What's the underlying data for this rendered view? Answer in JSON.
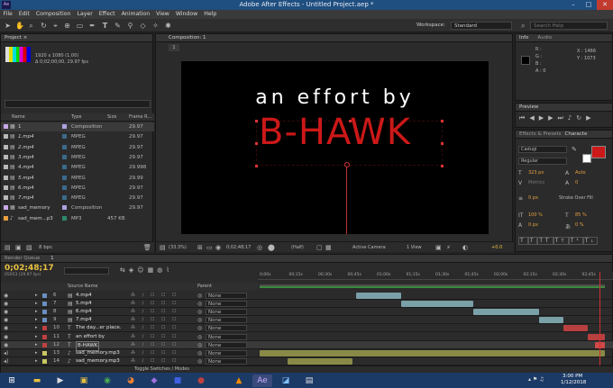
{
  "app": {
    "title": "Adobe After Effects - Untitled Project.aep *",
    "logo": "Ae",
    "menu": [
      "File",
      "Edit",
      "Composition",
      "Layer",
      "Effect",
      "Animation",
      "View",
      "Window",
      "Help"
    ],
    "workspace_label": "Workspace:",
    "workspace_value": "Standard",
    "search_placeholder": "Search Help"
  },
  "project": {
    "tab": "Project ×",
    "info_line1": "1920 x 1080 (1.00)",
    "info_line2": "Δ 0;02;00;00, 29.97 fps",
    "search_placeholder": "",
    "columns": [
      "Name",
      "Type",
      "Size",
      "Frame R..."
    ],
    "items": [
      {
        "name": "1",
        "type": "Composition",
        "size": "",
        "fps": "29.97",
        "color": "#c8a8e8"
      },
      {
        "name": "1.mp4",
        "type": "MPEG",
        "size": "",
        "fps": "29.97",
        "color": "#b8b8b8"
      },
      {
        "name": "2.mp4",
        "type": "MPEG",
        "size": "",
        "fps": "29.97",
        "color": "#b8b8b8"
      },
      {
        "name": "3.mp4",
        "type": "MPEG",
        "size": "",
        "fps": "29.97",
        "color": "#b8b8b8"
      },
      {
        "name": "4.mp4",
        "type": "MPEG",
        "size": "",
        "fps": "29.998",
        "color": "#b8b8b8"
      },
      {
        "name": "5.mp4",
        "type": "MPEG",
        "size": "",
        "fps": "29.99",
        "color": "#b8b8b8"
      },
      {
        "name": "6.mp4",
        "type": "MPEG",
        "size": "",
        "fps": "29.97",
        "color": "#b8b8b8"
      },
      {
        "name": "7.mp4",
        "type": "MPEG",
        "size": "",
        "fps": "29.97",
        "color": "#b8b8b8"
      },
      {
        "name": "sad_memory",
        "type": "Composition",
        "size": "",
        "fps": "29.97",
        "color": "#c8a8e8"
      },
      {
        "name": "sad_mem...p3",
        "type": "MP3",
        "size": "457 KB",
        "fps": "",
        "color": "#e8a040"
      }
    ],
    "bpc": "8 bpc"
  },
  "composition": {
    "tab": "Composition: 1",
    "sub_tab": "1",
    "line1": "an effort by",
    "line2": "B-HAWK",
    "zoom": "(33.3%)",
    "timecode": "0;02;48;17",
    "resolution": "(Half)",
    "camera": "Active Camera",
    "view": "1 View",
    "offset": "+0.0"
  },
  "info": {
    "tab": "Info",
    "tab2": "Audio",
    "r": "R :",
    "g": "G :",
    "b": "B :",
    "a": "A : 0",
    "x": "X : 1466",
    "y": "Y : 1073"
  },
  "preview": {
    "tab": "Preview"
  },
  "character": {
    "tab1": "Effects & Presets",
    "tab2": "Characte",
    "font": "Cadugi",
    "style": "Regular",
    "size": "323 px",
    "leading": "Auto",
    "tracking": "Metrics",
    "kerning": "0",
    "stroke_w": "0 px",
    "stroke_type": "Stroke Over Fill",
    "vscale": "100 %",
    "hscale": "85 %",
    "baseline": "0 px",
    "tsume": "0 %"
  },
  "timeline": {
    "render_tab": "Render Queue",
    "comp_tab": "1",
    "timecode": "0;02;48;17",
    "frames": "05053 (29.97 fps)",
    "header_source": "Source Name",
    "header_parent": "Parent",
    "ruler": [
      "0;00s",
      "00;15s",
      "00;30s",
      "00;45s",
      "01;00s",
      "01;15s",
      "01;30s",
      "01;45s",
      "02;00s",
      "02;15s",
      "02;30s",
      "02;45s"
    ],
    "layers": [
      {
        "num": "6",
        "name": "4.mp4",
        "parent": "None",
        "label": "#6a8fbf"
      },
      {
        "num": "7",
        "name": "5.mp4",
        "parent": "None",
        "label": "#6a8fbf"
      },
      {
        "num": "8",
        "name": "6.mp4",
        "parent": "None",
        "label": "#6a8fbf"
      },
      {
        "num": "9",
        "name": "7.mp4",
        "parent": "None",
        "label": "#6a8fbf"
      },
      {
        "num": "10",
        "name": "The day...er place.",
        "parent": "None",
        "label": "#c04040"
      },
      {
        "num": "11",
        "name": "an effort by",
        "parent": "None",
        "label": "#c04040"
      },
      {
        "num": "12",
        "name": "B-HAWK",
        "parent": "None",
        "label": "#c04040"
      },
      {
        "num": "13",
        "name": "sad_memory.mp3",
        "parent": "None",
        "label": "#c8c860"
      },
      {
        "num": "14",
        "name": "sad_memory.mp3",
        "parent": "None",
        "label": "#c8c860"
      }
    ],
    "toggle_label": "Toggle Switches / Modes"
  },
  "taskbar": {
    "time": "3:00 PM",
    "date": "1/12/2018"
  }
}
